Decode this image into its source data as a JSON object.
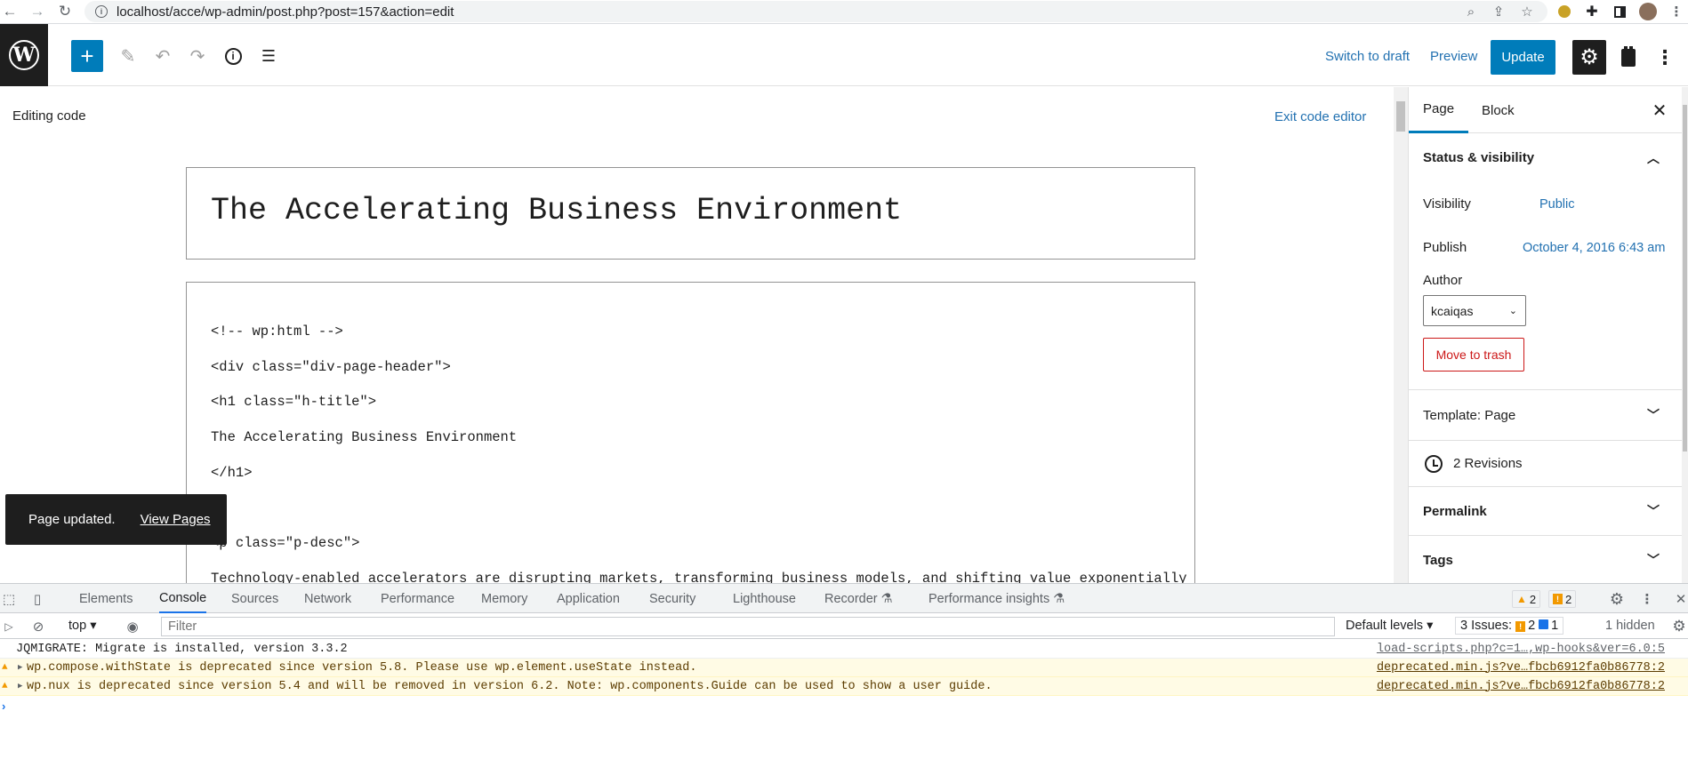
{
  "browser": {
    "url": "localhost/acce/wp-admin/post.php?post=157&action=edit"
  },
  "toolbar": {
    "switch_to_draft": "Switch to draft",
    "preview": "Preview",
    "update": "Update"
  },
  "editor": {
    "editing_label": "Editing code",
    "exit_code_editor": "Exit code editor",
    "title": "The Accelerating Business Environment",
    "code_lines": [
      "<!-- wp:html -->",
      "<div class=\"div-page-header\">",
      "<h1 class=\"h-title\">",
      "The Accelerating Business Environment",
      "</h1>",
      "",
      "<p class=\"p-desc\">",
      "Technology-enabled accelerators are disrupting markets, transforming business models, and shifting value exponentially"
    ]
  },
  "snackbar": {
    "message": "Page updated.",
    "action": "View Pages"
  },
  "sidebar": {
    "tabs": [
      "Page",
      "Block"
    ],
    "status_visibility": "Status & visibility",
    "visibility_label": "Visibility",
    "visibility_value": "Public",
    "publish_label": "Publish",
    "publish_value": "October 4, 2016 6:43 am",
    "author_label": "Author",
    "author_value": "kcaiqas",
    "move_to_trash": "Move to trash",
    "template": "Template: Page",
    "revisions": "2 Revisions",
    "permalink": "Permalink",
    "tags": "Tags"
  },
  "devtools": {
    "tabs": [
      "Elements",
      "Console",
      "Sources",
      "Network",
      "Performance",
      "Memory",
      "Application",
      "Security",
      "Lighthouse",
      "Recorder",
      "Performance insights"
    ],
    "warning_count": "2",
    "issue_count": "2",
    "context": "top",
    "filter_placeholder": "Filter",
    "default_levels": "Default levels",
    "issues_label": "3 Issues:",
    "issues_warn": "2",
    "issues_info": "1",
    "hidden": "1 hidden",
    "messages": [
      {
        "type": "log",
        "text": "JQMIGRATE: Migrate is installed, version 3.3.2",
        "source": "load-scripts.php?c=1…,wp-hooks&ver=6.0:5"
      },
      {
        "type": "warn",
        "text": "wp.compose.withState is deprecated since version 5.8. Please use wp.element.useState instead.",
        "source": "deprecated.min.js?ve…fbcb6912fa0b86778:2"
      },
      {
        "type": "warn",
        "text": "wp.nux is deprecated since version 5.4 and will be removed in version 6.2. Note: wp.components.Guide can be used to show a user guide.",
        "source": "deprecated.min.js?ve…fbcb6912fa0b86778:2"
      }
    ]
  }
}
